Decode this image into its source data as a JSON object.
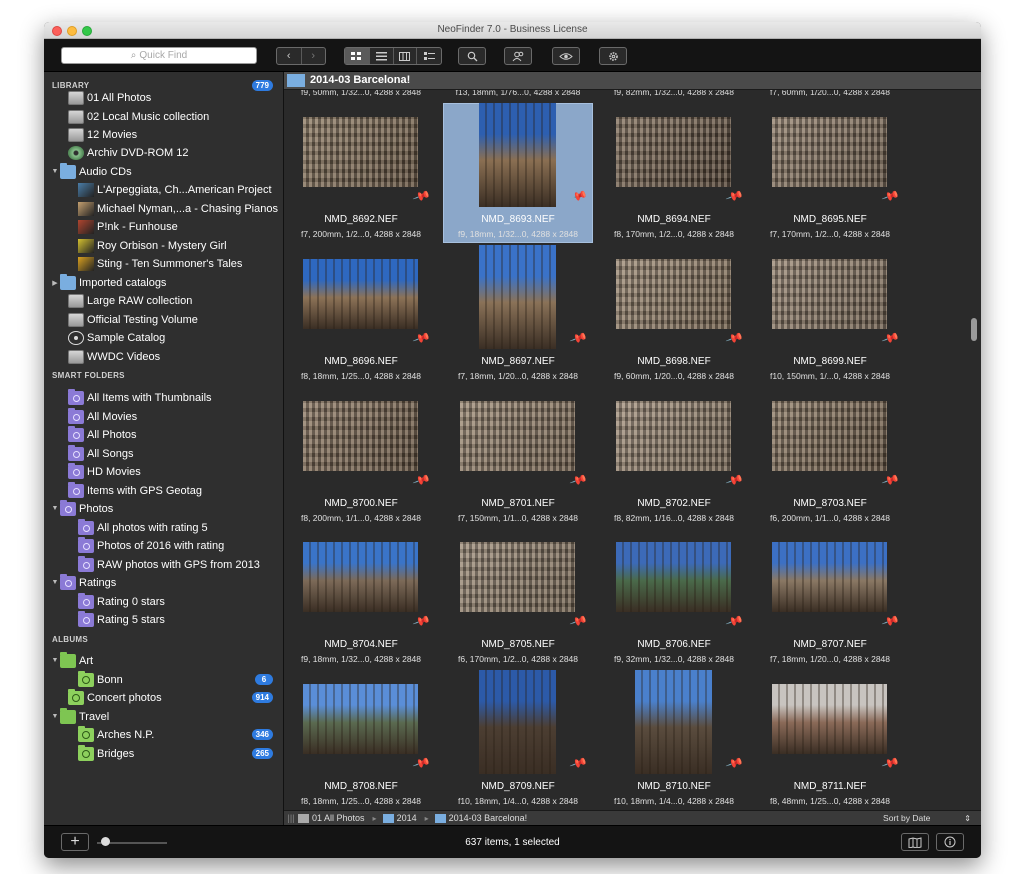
{
  "window": {
    "title": "NeoFinder 7.0 - Business License"
  },
  "toolbar": {
    "search_placeholder": "Quick Find",
    "nav_back": "‹",
    "nav_forward": "›"
  },
  "sidebar": {
    "library_header": "LIBRARY",
    "library_count": "779",
    "library_items": [
      {
        "label": "01 All Photos",
        "icon": "volume-icon"
      },
      {
        "label": "02 Local Music collection",
        "icon": "volume-icon"
      },
      {
        "label": "12 Movies",
        "icon": "volume-icon"
      },
      {
        "label": "Archiv DVD-ROM 12",
        "icon": "disc-icon"
      },
      {
        "label": "Audio CDs",
        "icon": "folder-icon"
      },
      {
        "label": "L'Arpeggiata, Ch...American Project",
        "icon": "album-cover-icon"
      },
      {
        "label": "Michael Nyman,...a - Chasing Pianos",
        "icon": "album-cover-icon"
      },
      {
        "label": "P!nk - Funhouse",
        "icon": "album-cover-icon"
      },
      {
        "label": "Roy Orbison - Mystery Girl",
        "icon": "album-cover-icon"
      },
      {
        "label": "Sting - Ten Summoner's Tales",
        "icon": "album-cover-icon"
      },
      {
        "label": "Imported catalogs",
        "icon": "folder-icon"
      },
      {
        "label": "Large RAW collection",
        "icon": "volume-icon"
      },
      {
        "label": "Official Testing Volume",
        "icon": "volume-icon"
      },
      {
        "label": "Sample Catalog",
        "icon": "catalog-icon"
      },
      {
        "label": "WWDC Videos",
        "icon": "volume-icon"
      }
    ],
    "smart_header": "SMART FOLDERS",
    "smart_items": [
      {
        "label": "All Items with Thumbnails"
      },
      {
        "label": "All Movies"
      },
      {
        "label": "All Photos"
      },
      {
        "label": "All Songs"
      },
      {
        "label": "HD Movies"
      },
      {
        "label": "Items with GPS Geotag"
      },
      {
        "label": "Photos"
      },
      {
        "label": "All photos with rating 5"
      },
      {
        "label": "Photos of 2016 with rating"
      },
      {
        "label": "RAW photos with GPS from 2013"
      },
      {
        "label": "Ratings"
      },
      {
        "label": "Rating 0 stars"
      },
      {
        "label": "Rating 5 stars"
      }
    ],
    "albums_header": "ALBUMS",
    "album_items": [
      {
        "label": "Art",
        "badge": ""
      },
      {
        "label": "Bonn",
        "badge": "6"
      },
      {
        "label": "Concert photos",
        "badge": "914"
      },
      {
        "label": "Travel",
        "badge": ""
      },
      {
        "label": "Arches N.P.",
        "badge": "346"
      },
      {
        "label": "Bridges",
        "badge": "265"
      }
    ]
  },
  "content": {
    "folder_title": "2014-03 Barcelona!",
    "top_meta": [
      "f9, 50mm, 1/32...0, 4288 x 2848",
      "f13, 18mm, 1/76...0, 4288 x 2848",
      "f9, 82mm, 1/32...0, 4288 x 2848",
      "f7, 60mm, 1/20...0, 4288 x 2848"
    ],
    "photos": [
      {
        "name": "NMD_8692.NEF",
        "meta": "f7, 200mm, 1/2...0, 4288 x 2848"
      },
      {
        "name": "NMD_8693.NEF",
        "meta": "f9, 18mm, 1/32...0, 4288 x 2848"
      },
      {
        "name": "NMD_8694.NEF",
        "meta": "f8, 170mm, 1/2...0, 4288 x 2848"
      },
      {
        "name": "NMD_8695.NEF",
        "meta": "f7, 170mm, 1/2...0, 4288 x 2848"
      },
      {
        "name": "NMD_8696.NEF",
        "meta": "f8, 18mm, 1/25...0, 4288 x 2848"
      },
      {
        "name": "NMD_8697.NEF",
        "meta": "f7, 18mm, 1/20...0, 4288 x 2848"
      },
      {
        "name": "NMD_8698.NEF",
        "meta": "f9, 60mm, 1/20...0, 4288 x 2848"
      },
      {
        "name": "NMD_8699.NEF",
        "meta": "f10, 150mm, 1/...0, 4288 x 2848"
      },
      {
        "name": "NMD_8700.NEF",
        "meta": "f8, 200mm, 1/1...0, 4288 x 2848"
      },
      {
        "name": "NMD_8701.NEF",
        "meta": "f7, 150mm, 1/1...0, 4288 x 2848"
      },
      {
        "name": "NMD_8702.NEF",
        "meta": "f8, 82mm, 1/16...0, 4288 x 2848"
      },
      {
        "name": "NMD_8703.NEF",
        "meta": "f6, 200mm, 1/1...0, 4288 x 2848"
      },
      {
        "name": "NMD_8704.NEF",
        "meta": "f9, 18mm, 1/32...0, 4288 x 2848"
      },
      {
        "name": "NMD_8705.NEF",
        "meta": "f6, 170mm, 1/2...0, 4288 x 2848"
      },
      {
        "name": "NMD_8706.NEF",
        "meta": "f9, 32mm, 1/32...0, 4288 x 2848"
      },
      {
        "name": "NMD_8707.NEF",
        "meta": "f7, 18mm, 1/20...0, 4288 x 2848"
      },
      {
        "name": "NMD_8708.NEF",
        "meta": "f8, 18mm, 1/25...0, 4288 x 2848"
      },
      {
        "name": "NMD_8709.NEF",
        "meta": "f10, 18mm, 1/4...0, 4288 x 2848"
      },
      {
        "name": "NMD_8710.NEF",
        "meta": "f10, 18mm, 1/4...0, 4288 x 2848"
      },
      {
        "name": "NMD_8711.NEF",
        "meta": "f8, 48mm, 1/25...0, 4288 x 2848"
      }
    ]
  },
  "pathbar": {
    "segments": [
      "01 All Photos",
      "2014",
      "2014-03 Barcelona!"
    ],
    "sort_label": "Sort by Date"
  },
  "status": {
    "text": "637 items, 1 selected",
    "add": "+"
  },
  "colors": {
    "accent": "#2e7be0",
    "selection": "#8ba7c9",
    "pin": "#f2542d"
  }
}
